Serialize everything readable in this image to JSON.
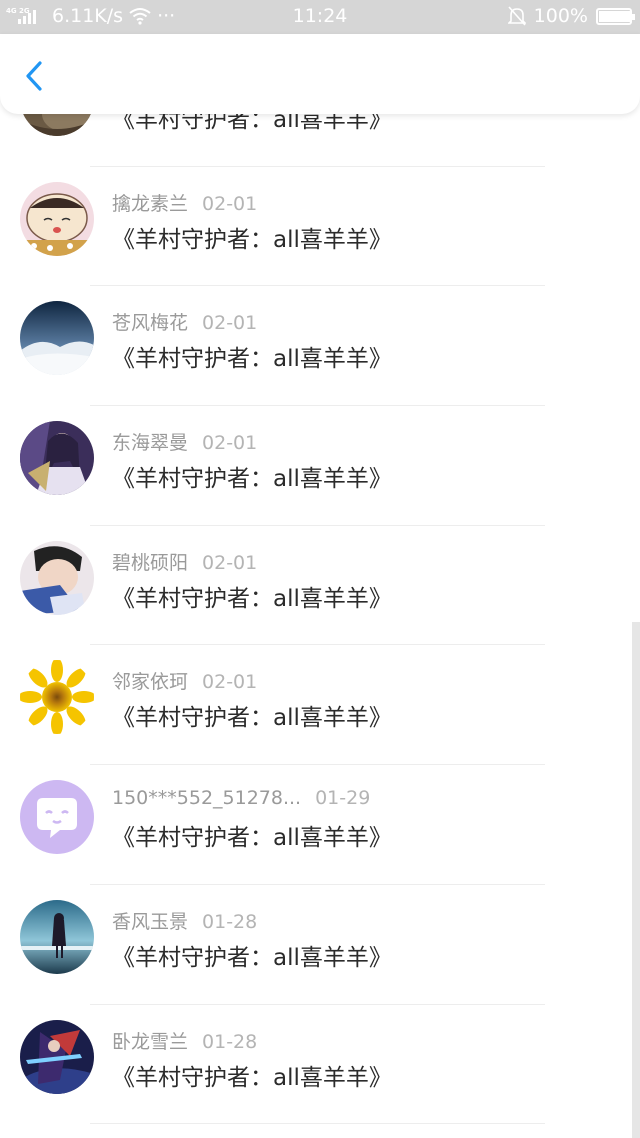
{
  "status_bar": {
    "network": "4G 2G",
    "speed": "6.11K/s",
    "more": "···",
    "time": "11:24",
    "battery": "100%",
    "battery_level": 1.0
  },
  "nav": {
    "back_icon": "chevron-left-icon",
    "accent": "#2196f3"
  },
  "comments": [
    {
      "user": "",
      "date": "",
      "text": "《羊村守护者：all喜羊羊》",
      "avatar": "cat-photo"
    },
    {
      "user": "擒龙素兰",
      "date": "02-01",
      "text": "《羊村守护者：all喜羊羊》",
      "avatar": "cartoon-boy"
    },
    {
      "user": "苍风梅花",
      "date": "02-01",
      "text": "《羊村守护者：all喜羊羊》",
      "avatar": "sky-clouds"
    },
    {
      "user": "东海翠曼",
      "date": "02-01",
      "text": "《羊村守护者：all喜羊羊》",
      "avatar": "anime-girl"
    },
    {
      "user": "碧桃硕阳",
      "date": "02-01",
      "text": "《羊村守护者：all喜羊羊》",
      "avatar": "boy-portrait"
    },
    {
      "user": "邻家依珂",
      "date": "02-01",
      "text": "《羊村守护者：all喜羊羊》",
      "avatar": "sunflower"
    },
    {
      "user": "150***552_51278...",
      "date": "01-29",
      "text": "《羊村守护者：all喜羊羊》",
      "avatar": "default-chat-face"
    },
    {
      "user": "香风玉景",
      "date": "01-28",
      "text": "《羊村守护者：all喜羊羊》",
      "avatar": "girl-silhouette"
    },
    {
      "user": "卧龙雪兰",
      "date": "01-28",
      "text": "《羊村守护者：all喜羊羊》",
      "avatar": "anime-warrior"
    }
  ]
}
